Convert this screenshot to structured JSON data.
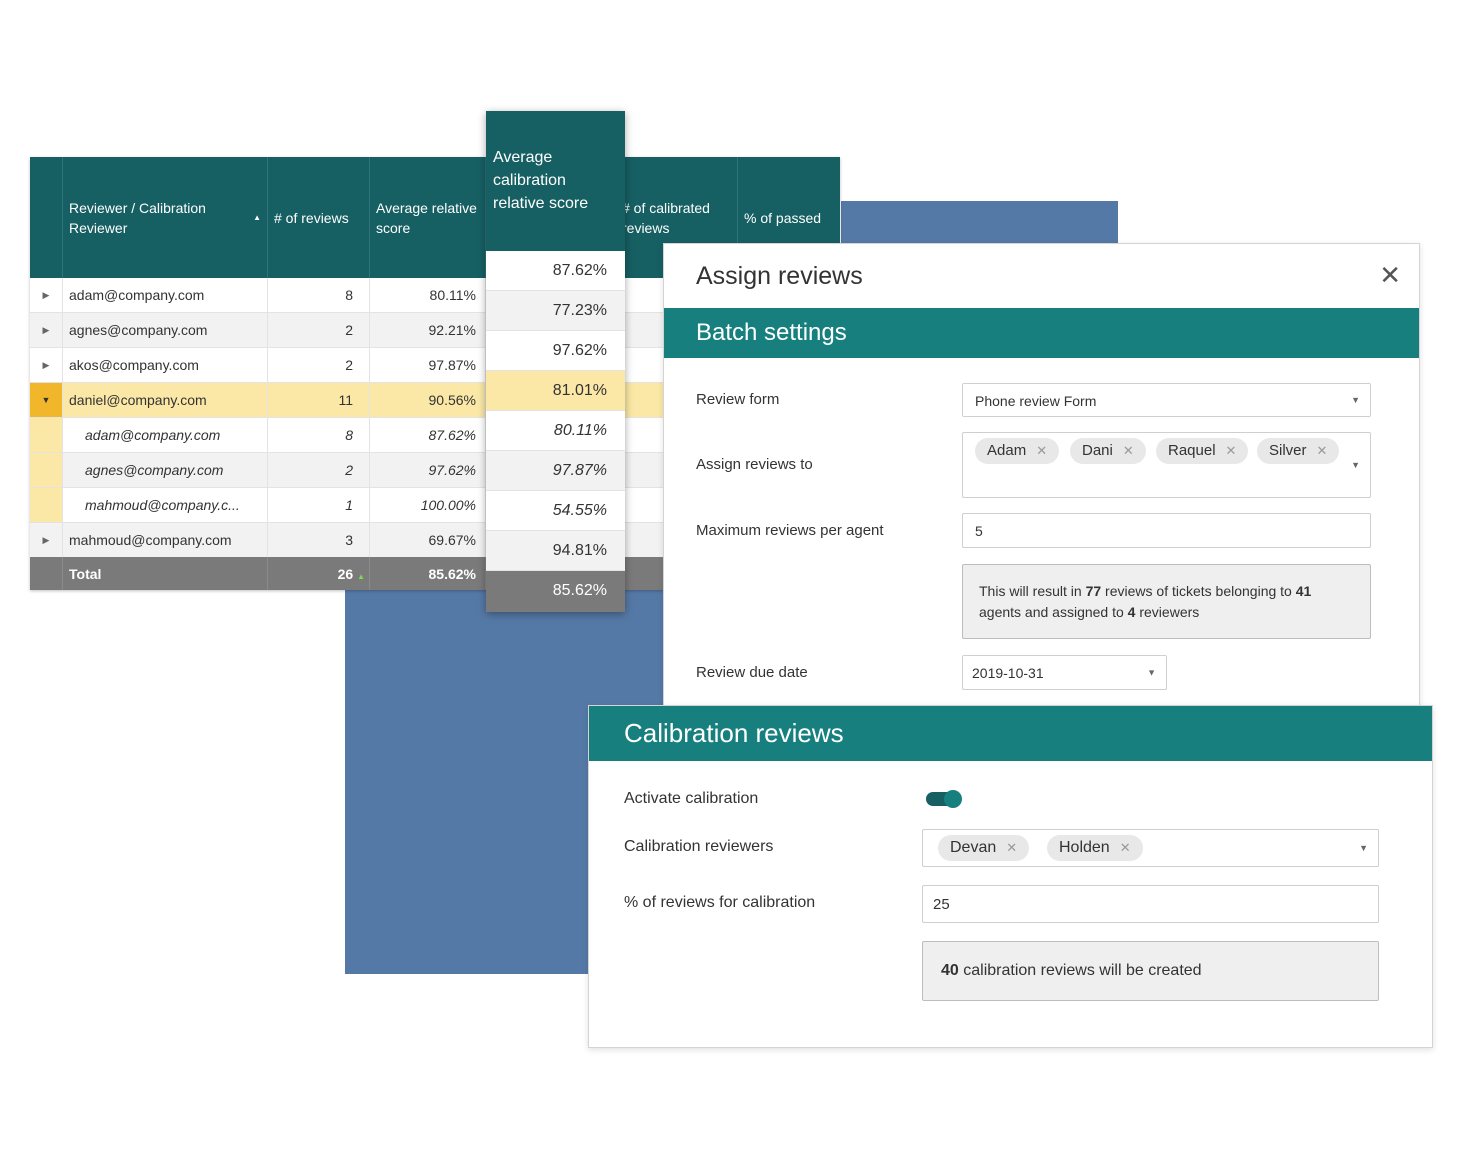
{
  "colors": {
    "header_dark_teal": "#165f63",
    "section_teal": "#17807f",
    "highlight_row": "#fbe8a6",
    "highlight_marker": "#f2b62b",
    "total_row": "#7a7a7a",
    "backdrop_blue": "#5579a6"
  },
  "table": {
    "columns": [
      {
        "label": "Reviewer / Calibration Reviewer",
        "sort_icon": "sort-ascending-icon"
      },
      {
        "label": "# of reviews"
      },
      {
        "label": "Average relative score"
      },
      {
        "label": "Average calibration relative score"
      },
      {
        "label": "# of calibrated reviews"
      },
      {
        "label": "% of passed"
      }
    ],
    "rows": [
      {
        "reviewer": "adam@company.com",
        "reviews": "8",
        "avg": "80.11%",
        "cal_avg": "87.62%"
      },
      {
        "reviewer": "agnes@company.com",
        "reviews": "2",
        "avg": "92.21%",
        "cal_avg": "77.23%"
      },
      {
        "reviewer": "akos@company.com",
        "reviews": "2",
        "avg": "97.87%",
        "cal_avg": "97.62%"
      },
      {
        "reviewer": "daniel@company.com",
        "reviews": "11",
        "avg": "90.56%",
        "cal_avg": "81.01%"
      },
      {
        "reviewer": "adam@company.com",
        "reviews": "8",
        "avg": "87.62%",
        "cal_avg": "80.11%"
      },
      {
        "reviewer": "agnes@company.com",
        "reviews": "2",
        "avg": "97.62%",
        "cal_avg": "97.87%"
      },
      {
        "reviewer": "mahmoud@company.c...",
        "reviews": "1",
        "avg": "100.00%",
        "cal_avg": "54.55%"
      },
      {
        "reviewer": "mahmoud@company.com",
        "reviews": "3",
        "avg": "69.67%",
        "cal_avg": "94.81%"
      }
    ],
    "total": {
      "label": "Total",
      "reviews": "26",
      "avg": "85.62%",
      "cal_avg": "85.62%"
    }
  },
  "assign_dialog": {
    "title": "Assign reviews",
    "close_icon": "close-icon",
    "section_title": "Batch settings",
    "review_form": {
      "label": "Review form",
      "value": "Phone review Form"
    },
    "assign_to": {
      "label": "Assign reviews to",
      "tags": [
        "Adam",
        "Dani",
        "Raquel",
        "Silver"
      ]
    },
    "max_per_agent": {
      "label": "Maximum reviews per agent",
      "value": "5"
    },
    "info": {
      "part1": "This will result in ",
      "reviews_count": "77",
      "part2": " reviews of tickets belonging to ",
      "agents_count": "41",
      "part3": " agents and assigned to ",
      "reviewers_count": "4",
      "part4": " reviewers"
    },
    "due_date": {
      "label": "Review due date",
      "value": "2019-10-31"
    }
  },
  "calibration": {
    "title": "Calibration reviews",
    "activate": {
      "label": "Activate calibration",
      "enabled": true
    },
    "reviewers": {
      "label": "Calibration reviewers",
      "tags": [
        "Devan",
        "Holden"
      ]
    },
    "percent": {
      "label": "% of reviews for calibration",
      "value": "25"
    },
    "info": {
      "count": "40",
      "text": " calibration reviews will be created"
    }
  }
}
